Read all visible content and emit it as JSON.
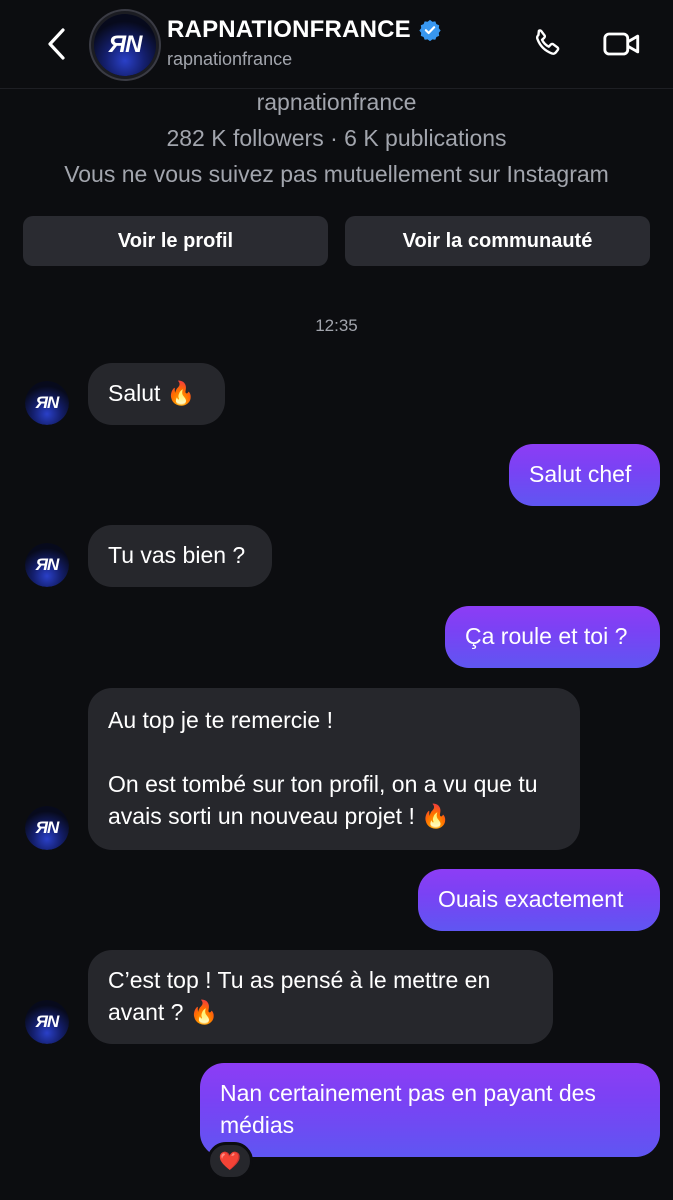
{
  "header": {
    "title": "RAPNATIONFRANCE",
    "username": "rapnationfrance",
    "avatar_text": "ЯN",
    "icons": [
      "back-chevron-icon",
      "verified-badge-icon",
      "phone-icon",
      "video-camera-icon"
    ]
  },
  "profile": {
    "username": "rapnationfrance",
    "stats": "282 K followers · 6 K publications",
    "relation": "Vous ne vous suivez pas mutuellement sur Instagram",
    "view_profile_label": "Voir le profil",
    "view_community_label": "Voir la communauté"
  },
  "chat": {
    "timestamp": "12:35",
    "messages": [
      {
        "from": "them",
        "text": "Salut 🔥"
      },
      {
        "from": "me",
        "text": "Salut chef"
      },
      {
        "from": "them",
        "text": "Tu vas bien ?"
      },
      {
        "from": "me",
        "text": "Ça roule et toi ?"
      },
      {
        "from": "them",
        "text": "Au top je te remercie !\n\nOn est tombé sur ton profil, on a vu que tu avais sorti un nouveau projet ! 🔥"
      },
      {
        "from": "me",
        "text": "Ouais exactement"
      },
      {
        "from": "them",
        "text": "C’est top ! Tu as pensé à le mettre en avant ? 🔥"
      },
      {
        "from": "me",
        "text": "Nan certainement pas en payant des médias",
        "reaction": "❤️"
      }
    ]
  },
  "colors": {
    "background": "#0c0d10",
    "incoming_bubble": "#26272c",
    "outgoing_bubble_top": "#8d3df5",
    "outgoing_bubble_bottom": "#5f56f2",
    "verified": "#3897f0",
    "secondary_text": "#a2a5ad"
  }
}
